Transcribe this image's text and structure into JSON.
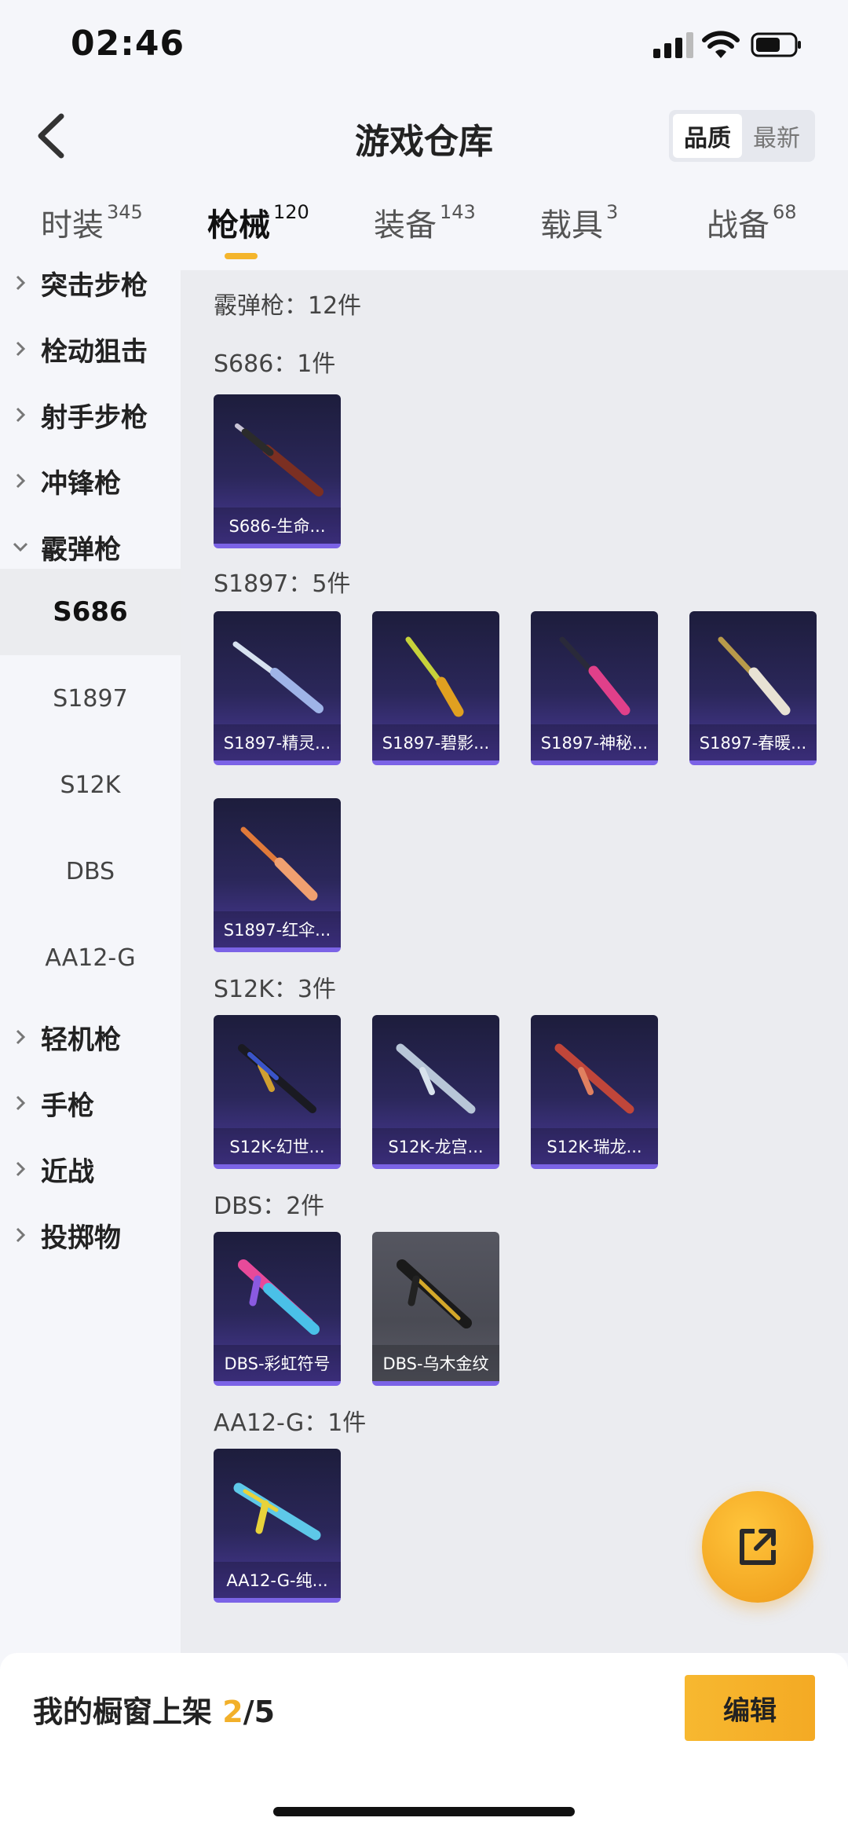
{
  "status_bar": {
    "time": "02:46"
  },
  "header": {
    "title": "游戏仓库",
    "sort_options": [
      "品质",
      "最新"
    ],
    "active_sort": "品质"
  },
  "tabs": [
    {
      "label": "时装",
      "count": "345"
    },
    {
      "label": "枪械",
      "count": "120"
    },
    {
      "label": "装备",
      "count": "143"
    },
    {
      "label": "载具",
      "count": "3"
    },
    {
      "label": "战备",
      "count": "68"
    }
  ],
  "active_tab": "枪械",
  "sidebar": {
    "groups_top": [
      "突击步枪",
      "栓动狙击",
      "射手步枪",
      "冲锋枪"
    ],
    "expanded_group": "霰弹枪",
    "sub_items": [
      "S686",
      "S1897",
      "S12K",
      "DBS",
      "AA12-G"
    ],
    "active_sub": "S686",
    "groups_bottom": [
      "轻机枪",
      "手枪",
      "近战",
      "投掷物"
    ]
  },
  "content": {
    "category_summary": "霰弹枪：12件",
    "sections": [
      {
        "title": "S686：1件",
        "items": [
          "S686-生命..."
        ]
      },
      {
        "title": "S1897：5件",
        "items": [
          "S1897-精灵...",
          "S1897-碧影...",
          "S1897-神秘...",
          "S1897-春暖...",
          "S1897-红伞..."
        ]
      },
      {
        "title": "S12K：3件",
        "items": [
          "S12K-幻世...",
          "S12K-龙宫...",
          "S12K-瑞龙..."
        ]
      },
      {
        "title": "DBS：2件",
        "items": [
          "DBS-彩虹符号",
          "DBS-乌木金纹"
        ]
      },
      {
        "title": "AA12-G：1件",
        "items": [
          "AA12-G-纯..."
        ]
      }
    ]
  },
  "bottom_bar": {
    "label": "我的橱窗上架",
    "current": "2",
    "total": "/5",
    "edit_label": "编辑"
  },
  "colors": {
    "accent": "#f4b52c",
    "card_border": "#7b63e6",
    "card_bg_top": "#1d1d3c",
    "card_bg_bottom": "#4a3a9a"
  },
  "icons": [
    "back-chevron-icon",
    "signal-icon",
    "wifi-icon",
    "battery-icon",
    "share-export-icon",
    "chevron-right-icon",
    "chevron-down-icon"
  ]
}
